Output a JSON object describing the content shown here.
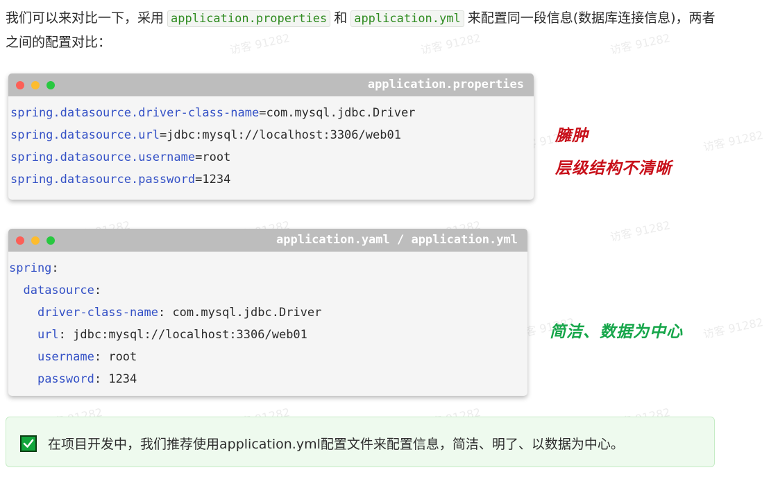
{
  "intro": {
    "text_before": "我们可以来对比一下，采用",
    "code_a": "application.properties",
    "text_mid": "和",
    "code_b": "application.yml",
    "text_after": "来配置同一段信息(数据库连接信息)，两者之间的配置对比："
  },
  "properties_box": {
    "title": "application.properties",
    "lines": [
      {
        "key": "spring.datasource.driver-class-name",
        "value": "com.mysql.jdbc.Driver"
      },
      {
        "key": "spring.datasource.url",
        "value": "jdbc:mysql://localhost:3306/web01"
      },
      {
        "key": "spring.datasource.username",
        "value": "root"
      },
      {
        "key": "spring.datasource.password",
        "value": "1234"
      }
    ]
  },
  "yaml_box": {
    "title": "application.yaml / application.yml",
    "lines": [
      {
        "key": "spring",
        "value": "",
        "indent": 0
      },
      {
        "key": "datasource",
        "value": "",
        "indent": 1
      },
      {
        "key": "driver-class-name",
        "value": "com.mysql.jdbc.Driver",
        "indent": 2
      },
      {
        "key": "url",
        "value": "jdbc:mysql://localhost:3306/web01",
        "indent": 2
      },
      {
        "key": "username",
        "value": "root",
        "indent": 2
      },
      {
        "key": "password",
        "value": "1234",
        "indent": 2
      }
    ]
  },
  "annotations": {
    "red_line1": "臃肿",
    "red_line2": "层级结构不清晰",
    "green": "简洁、数据为中心"
  },
  "tip": {
    "text": "在项目开发中，我们推荐使用application.yml配置文件来配置信息，简洁、明了、以数据为中心。"
  },
  "watermark": "访客 91282",
  "colors": {
    "key": "#3451c6",
    "inline_code": "#2e8b1f",
    "annotation_red": "#c8101a",
    "annotation_green": "#16a64a",
    "tip_check": "#11a63c"
  }
}
